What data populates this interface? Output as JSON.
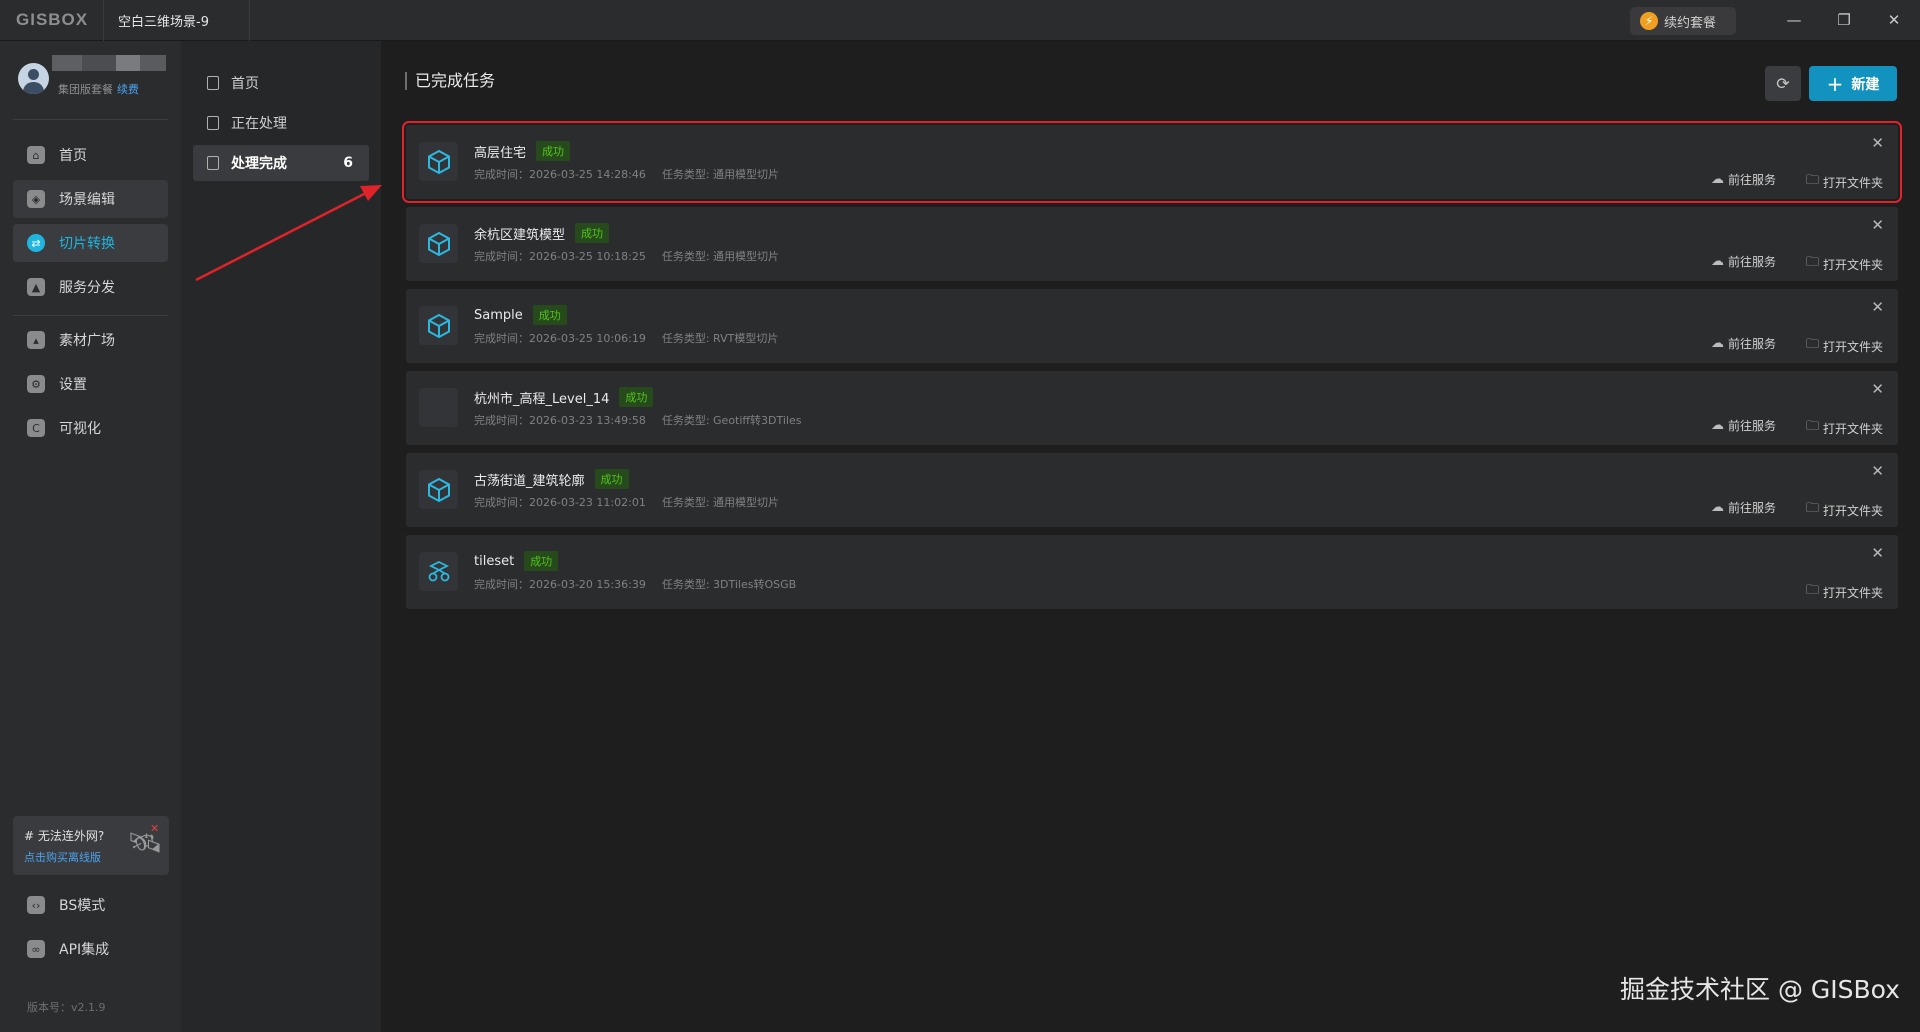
{
  "app": {
    "logo": "GISBOX",
    "doc_tab": "空白三维场景-9",
    "renew_label": "续约套餐"
  },
  "user": {
    "plan": "集团版套餐",
    "renew_link": "续费"
  },
  "sidebar": {
    "items": [
      {
        "label": "首页",
        "icon": "home-icon"
      },
      {
        "label": "场景编辑",
        "icon": "cube-icon"
      },
      {
        "label": "切片转换",
        "icon": "exchange-icon"
      },
      {
        "label": "服务分发",
        "icon": "upload-cloud-icon"
      },
      {
        "label": "素材广场",
        "icon": "image-icon"
      },
      {
        "label": "设置",
        "icon": "gear-icon"
      },
      {
        "label": "可视化",
        "icon": "chart-icon"
      }
    ],
    "offline_title": "# 无法连外网?",
    "offline_link": "点击购买离线版",
    "bottom_items": [
      {
        "label": "BS模式",
        "icon": "code-icon"
      },
      {
        "label": "API集成",
        "icon": "link-icon"
      }
    ],
    "version": "版本号：v2.1.9"
  },
  "subnav": {
    "items": [
      {
        "label": "首页"
      },
      {
        "label": "正在处理"
      },
      {
        "label": "处理完成",
        "count": "6"
      }
    ]
  },
  "main": {
    "title": "已完成任务",
    "new_label": "新建",
    "tasks": [
      {
        "name": "高层住宅",
        "status": "成功",
        "time": "完成时间：2026-03-25 14:28:46",
        "type": "任务类型: 通用模型切片",
        "goto": "前往服务",
        "open": "打开文件夹"
      },
      {
        "name": "余杭区建筑模型",
        "status": "成功",
        "time": "完成时间：2026-03-25 10:18:25",
        "type": "任务类型: 通用模型切片",
        "goto": "前往服务",
        "open": "打开文件夹"
      },
      {
        "name": "Sample",
        "status": "成功",
        "time": "完成时间：2026-03-25 10:06:19",
        "type": "任务类型: RVT模型切片",
        "goto": "前往服务",
        "open": "打开文件夹"
      },
      {
        "name": "杭州市_高程_Level_14",
        "status": "成功",
        "time": "完成时间：2026-03-23 13:49:58",
        "type": "任务类型: Geotiff转3DTiles",
        "goto": "前往服务",
        "open": "打开文件夹"
      },
      {
        "name": "古荡街道_建筑轮廓",
        "status": "成功",
        "time": "完成时间：2026-03-23 11:02:01",
        "type": "任务类型: 通用模型切片",
        "goto": "前往服务",
        "open": "打开文件夹"
      },
      {
        "name": "tileset",
        "status": "成功",
        "time": "完成时间：2026-03-20 15:36:39",
        "type": "任务类型: 3DTiles转OSGB",
        "open": "打开文件夹"
      }
    ]
  },
  "watermark": "掘金技术社区 @ GISBox",
  "colors": {
    "accent": "#1fb5de",
    "primary_button": "#1292be",
    "success": "#52c41a",
    "highlight_box": "#e0222a"
  }
}
